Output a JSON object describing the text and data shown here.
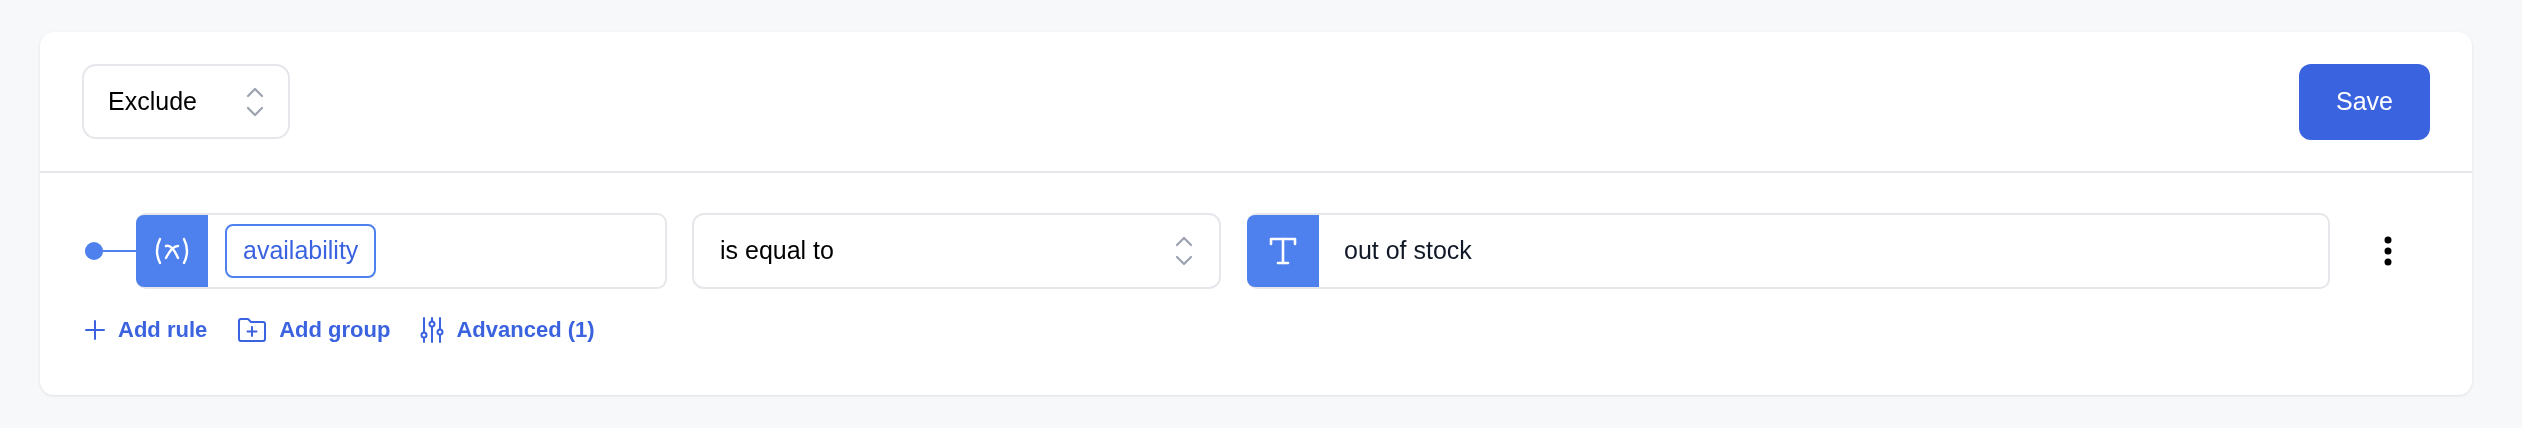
{
  "header": {
    "mode_select": {
      "value": "Exclude"
    },
    "save_button": {
      "label": "Save"
    }
  },
  "rules": [
    {
      "field": {
        "kind": "variable",
        "value": "availability"
      },
      "operator": {
        "value": "is equal to"
      },
      "value": {
        "kind": "text",
        "value": "out of stock"
      }
    }
  ],
  "actions": [
    {
      "kind": "add_rule",
      "label": "Add rule"
    },
    {
      "kind": "add_group",
      "label": "Add group"
    },
    {
      "kind": "advanced",
      "label": "Advanced (1)"
    }
  ]
}
